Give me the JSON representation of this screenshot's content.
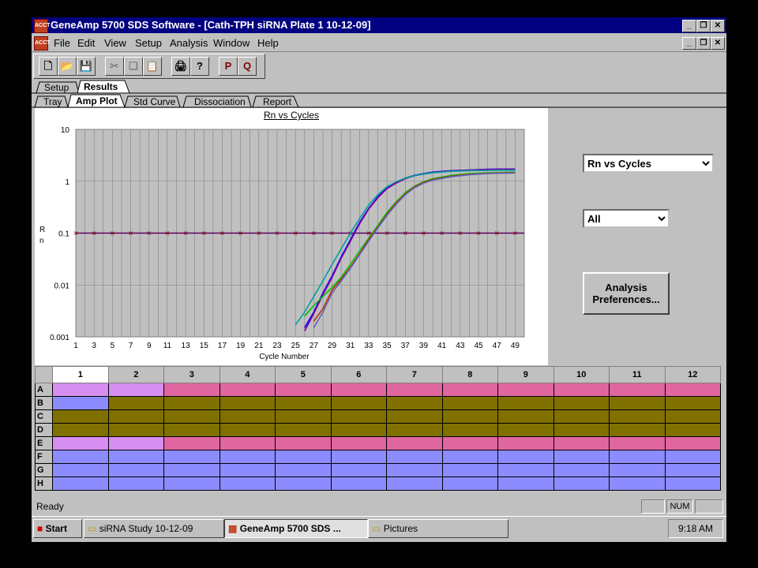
{
  "window": {
    "title": "GeneAmp 5700 SDS Software - [Cath-TPH siRNA Plate 1 10-12-09]",
    "app_icon_text": "ACCT"
  },
  "menu": [
    "File",
    "Edit",
    "View",
    "Setup",
    "Analysis",
    "Window",
    "Help"
  ],
  "toolbar": [
    "new-icon",
    "open-icon",
    "save-icon",
    "cut-icon",
    "copy-icon",
    "paste-icon",
    "print-icon",
    "help-icon",
    "P",
    "Q"
  ],
  "tabs_top": [
    "Setup",
    "Results"
  ],
  "tabs_sub": [
    "Tray",
    "Amp Plot",
    "Std Curve",
    "Dissociation",
    "Report"
  ],
  "plot": {
    "title": "Rn vs Cycles",
    "xlabel": "Cycle Number",
    "ylabel": "Rn"
  },
  "controls": {
    "view_select": "Rn vs Cycles",
    "filter_select": "All",
    "analysis_button": "Analysis Preferences..."
  },
  "grid": {
    "columns": [
      "1",
      "2",
      "3",
      "4",
      "5",
      "6",
      "7",
      "8",
      "9",
      "10",
      "11",
      "12"
    ],
    "rows": [
      "A",
      "B",
      "C",
      "D",
      "E",
      "F",
      "G",
      "H"
    ],
    "colors": {
      "pink": "#e066a0",
      "lilac": "#d68ef0",
      "olive": "#807000",
      "blue": "#8c8cff"
    }
  },
  "status": {
    "text": "Ready",
    "num": "NUM"
  },
  "taskbar": {
    "start": "Start",
    "tasks": [
      "siRNA Study 10-12-09",
      "GeneAmp 5700 SDS ...",
      "Pictures"
    ],
    "clock": "9:18 AM"
  },
  "chart_data": {
    "type": "line",
    "title": "Rn vs Cycles",
    "xlabel": "Cycle Number",
    "ylabel": "Rn",
    "yscale": "log",
    "ylim": [
      0.001,
      10
    ],
    "xlim": [
      1,
      50
    ],
    "x_ticks": [
      "1",
      "3",
      "5",
      "7",
      "9",
      "11",
      "13",
      "15",
      "17",
      "19",
      "21",
      "23",
      "25",
      "27",
      "29",
      "31",
      "33",
      "35",
      "37",
      "39",
      "41",
      "43",
      "45",
      "47",
      "49"
    ],
    "y_ticks": [
      "10",
      "1",
      "0.1",
      "0.01",
      "0.001"
    ],
    "threshold": 0.1,
    "series": [
      {
        "color": "#0000ff",
        "x": [
          26,
          27,
          28,
          29,
          30,
          31,
          32,
          33,
          34,
          35,
          36,
          37,
          38,
          39,
          40,
          42,
          44,
          46,
          48,
          49
        ],
        "y": [
          0.0015,
          0.003,
          0.007,
          0.015,
          0.035,
          0.075,
          0.16,
          0.3,
          0.5,
          0.75,
          0.95,
          1.15,
          1.3,
          1.4,
          1.5,
          1.6,
          1.65,
          1.7,
          1.72,
          1.72
        ]
      },
      {
        "color": "#8000a0",
        "x": [
          26,
          27,
          28,
          29,
          30,
          31,
          32,
          33,
          34,
          35,
          36,
          37,
          38,
          39,
          40,
          42,
          44,
          46,
          48,
          49
        ],
        "y": [
          0.0013,
          0.0028,
          0.0065,
          0.014,
          0.033,
          0.07,
          0.15,
          0.29,
          0.48,
          0.72,
          0.92,
          1.12,
          1.28,
          1.38,
          1.48,
          1.58,
          1.64,
          1.68,
          1.7,
          1.7
        ]
      },
      {
        "color": "#00a0a0",
        "x": [
          25,
          26,
          27,
          28,
          29,
          30,
          31,
          32,
          33,
          34,
          35,
          36,
          37,
          38,
          39,
          40,
          42,
          44,
          46,
          48,
          49
        ],
        "y": [
          0.0017,
          0.003,
          0.006,
          0.012,
          0.025,
          0.05,
          0.1,
          0.19,
          0.35,
          0.55,
          0.78,
          0.98,
          1.15,
          1.28,
          1.38,
          1.45,
          1.55,
          1.6,
          1.62,
          1.63,
          1.63
        ]
      },
      {
        "color": "#00c000",
        "x": [
          26,
          27,
          28,
          29,
          30,
          31,
          32,
          33,
          34,
          35,
          36,
          37,
          38,
          39,
          40,
          42,
          44,
          46,
          48,
          49
        ],
        "y": [
          0.0025,
          0.004,
          0.006,
          0.009,
          0.014,
          0.025,
          0.045,
          0.08,
          0.14,
          0.25,
          0.4,
          0.6,
          0.8,
          0.98,
          1.12,
          1.3,
          1.4,
          1.45,
          1.48,
          1.5
        ]
      },
      {
        "color": "#c03000",
        "x": [
          27,
          28,
          29,
          30,
          31,
          32,
          33,
          34,
          35,
          36,
          37,
          38,
          39,
          40,
          42,
          44,
          46,
          48,
          49
        ],
        "y": [
          0.002,
          0.0035,
          0.008,
          0.013,
          0.022,
          0.04,
          0.075,
          0.13,
          0.23,
          0.38,
          0.57,
          0.78,
          0.95,
          1.08,
          1.25,
          1.36,
          1.42,
          1.45,
          1.46
        ]
      },
      {
        "color": "#6060c0",
        "x": [
          27,
          28,
          29,
          30,
          31,
          32,
          33,
          34,
          35,
          36,
          37,
          38,
          39,
          40,
          42,
          44,
          46,
          48,
          49
        ],
        "y": [
          0.0015,
          0.003,
          0.007,
          0.012,
          0.021,
          0.038,
          0.07,
          0.125,
          0.22,
          0.36,
          0.55,
          0.75,
          0.92,
          1.05,
          1.22,
          1.33,
          1.4,
          1.43,
          1.44
        ]
      }
    ]
  }
}
